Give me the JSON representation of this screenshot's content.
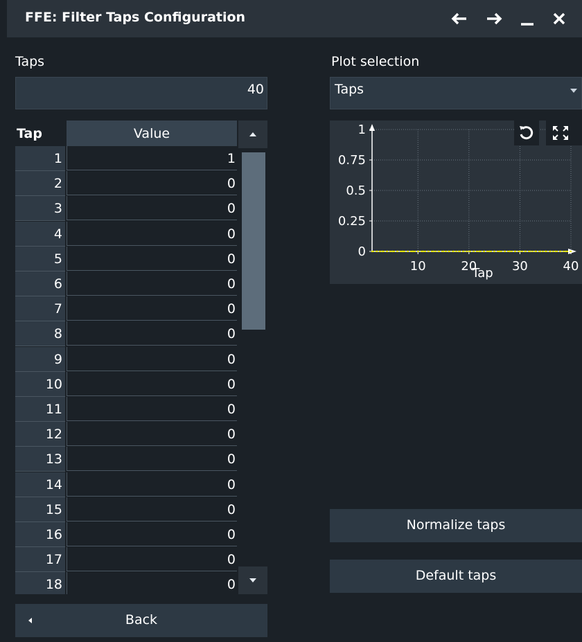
{
  "window": {
    "title": "FFE: Filter Taps Configuration"
  },
  "taps": {
    "label": "Taps",
    "value": "40"
  },
  "table": {
    "headers": {
      "tap": "Tap",
      "value": "Value"
    },
    "rows": [
      {
        "tap": "1",
        "value": "1"
      },
      {
        "tap": "2",
        "value": "0"
      },
      {
        "tap": "3",
        "value": "0"
      },
      {
        "tap": "4",
        "value": "0"
      },
      {
        "tap": "5",
        "value": "0"
      },
      {
        "tap": "6",
        "value": "0"
      },
      {
        "tap": "7",
        "value": "0"
      },
      {
        "tap": "8",
        "value": "0"
      },
      {
        "tap": "9",
        "value": "0"
      },
      {
        "tap": "10",
        "value": "0"
      },
      {
        "tap": "11",
        "value": "0"
      },
      {
        "tap": "12",
        "value": "0"
      },
      {
        "tap": "13",
        "value": "0"
      },
      {
        "tap": "14",
        "value": "0"
      },
      {
        "tap": "15",
        "value": "0"
      },
      {
        "tap": "16",
        "value": "0"
      },
      {
        "tap": "17",
        "value": "0"
      },
      {
        "tap": "18",
        "value": "0"
      }
    ]
  },
  "plot_selection": {
    "label": "Plot selection",
    "selected": "Taps"
  },
  "plot": {
    "xlabel": "Tap",
    "x_ticks": [
      "10",
      "20",
      "30",
      "40"
    ],
    "y_ticks": [
      "0",
      "0.25",
      "0.5",
      "0.75",
      "1"
    ]
  },
  "chart_data": {
    "type": "line",
    "title": "",
    "xlabel": "Tap",
    "ylabel": "",
    "xlim": [
      1,
      40
    ],
    "ylim": [
      0,
      1
    ],
    "x_ticks": [
      10,
      20,
      30,
      40
    ],
    "y_ticks": [
      0,
      0.25,
      0.5,
      0.75,
      1
    ],
    "grid": true,
    "series": [
      {
        "x": [
          1,
          2,
          3,
          4,
          5,
          6,
          7,
          8,
          9,
          10,
          11,
          12,
          13,
          14,
          15,
          16,
          17,
          18,
          19,
          20,
          21,
          22,
          23,
          24,
          25,
          26,
          27,
          28,
          29,
          30,
          31,
          32,
          33,
          34,
          35,
          36,
          37,
          38,
          39,
          40
        ],
        "values": [
          0,
          0,
          0,
          0,
          0,
          0,
          0,
          0,
          0,
          0,
          0,
          0,
          0,
          0,
          0,
          0,
          0,
          0,
          0,
          0,
          0,
          0,
          0,
          0,
          0,
          0,
          0,
          0,
          0,
          0,
          0,
          0,
          0,
          0,
          0,
          0,
          0,
          0,
          0,
          0
        ],
        "color": "#e6e600"
      }
    ]
  },
  "buttons": {
    "normalize": "Normalize taps",
    "default": "Default taps",
    "back": "Back"
  },
  "icons": {
    "back": "arrow-left-icon",
    "forward": "arrow-right-icon",
    "minimize": "minimize-icon",
    "close": "close-icon",
    "reset": "reset-icon",
    "fullscreen": "fullscreen-icon"
  },
  "colors": {
    "background": "#1b2127",
    "panel": "#2b333b",
    "field": "#2d3944",
    "trace": "#e6e600"
  }
}
